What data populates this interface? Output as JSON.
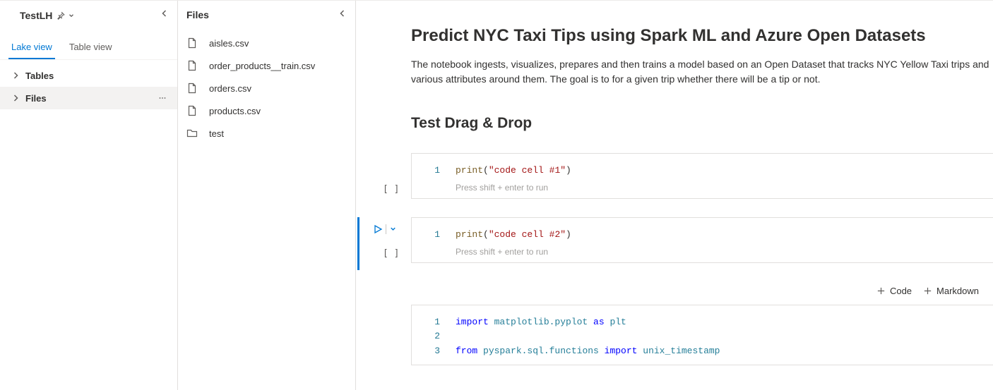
{
  "sidebar": {
    "title": "TestLH",
    "tabs": [
      {
        "label": "Lake view",
        "active": true
      },
      {
        "label": "Table view",
        "active": false
      }
    ],
    "tree": [
      {
        "label": "Tables",
        "selected": false
      },
      {
        "label": "Files",
        "selected": true
      }
    ]
  },
  "filesPanel": {
    "title": "Files",
    "items": [
      {
        "name": "aisles.csv",
        "type": "file"
      },
      {
        "name": "order_products__train.csv",
        "type": "file"
      },
      {
        "name": "orders.csv",
        "type": "file"
      },
      {
        "name": "products.csv",
        "type": "file"
      },
      {
        "name": "test",
        "type": "folder"
      }
    ]
  },
  "notebook": {
    "h1": "Predict NYC Taxi Tips using Spark ML and Azure Open Datasets",
    "intro": "The notebook ingests, visualizes, prepares and then trains a model based on an Open Dataset that tracks NYC Yellow Taxi trips and various attributes around them. The goal is to for a given trip whether there will be a tip or not.",
    "h2": "Test Drag & Drop",
    "hint": "Press shift + enter to run",
    "cells": [
      {
        "exec": "[ ]",
        "lines": [
          {
            "n": "1",
            "tokens": [
              {
                "t": "print",
                "c": "fn"
              },
              {
                "t": "("
              },
              {
                "t": "\"code cell #1\"",
                "c": "str"
              },
              {
                "t": ")"
              }
            ]
          }
        ],
        "active": false,
        "showRun": false
      },
      {
        "exec": "[ ]",
        "lines": [
          {
            "n": "1",
            "tokens": [
              {
                "t": "print",
                "c": "fn"
              },
              {
                "t": "("
              },
              {
                "t": "\"code cell #2\"",
                "c": "str"
              },
              {
                "t": ")"
              }
            ]
          }
        ],
        "active": true,
        "showRun": true
      },
      {
        "exec": "",
        "lines": [
          {
            "n": "1",
            "tokens": [
              {
                "t": "import ",
                "c": "kw"
              },
              {
                "t": "matplotlib.pyplot",
                "c": "mod"
              },
              {
                "t": " as ",
                "c": "kw"
              },
              {
                "t": "plt",
                "c": "mod"
              }
            ]
          },
          {
            "n": "2",
            "tokens": [
              {
                "t": ""
              }
            ]
          },
          {
            "n": "3",
            "tokens": [
              {
                "t": "from ",
                "c": "kw"
              },
              {
                "t": "pyspark.sql.functions",
                "c": "mod"
              },
              {
                "t": " import ",
                "c": "kw"
              },
              {
                "t": "unix_timestamp",
                "c": "mod"
              }
            ]
          }
        ],
        "active": false,
        "showRun": false,
        "noHint": true
      }
    ],
    "insert": {
      "code": "Code",
      "markdown": "Markdown"
    }
  }
}
